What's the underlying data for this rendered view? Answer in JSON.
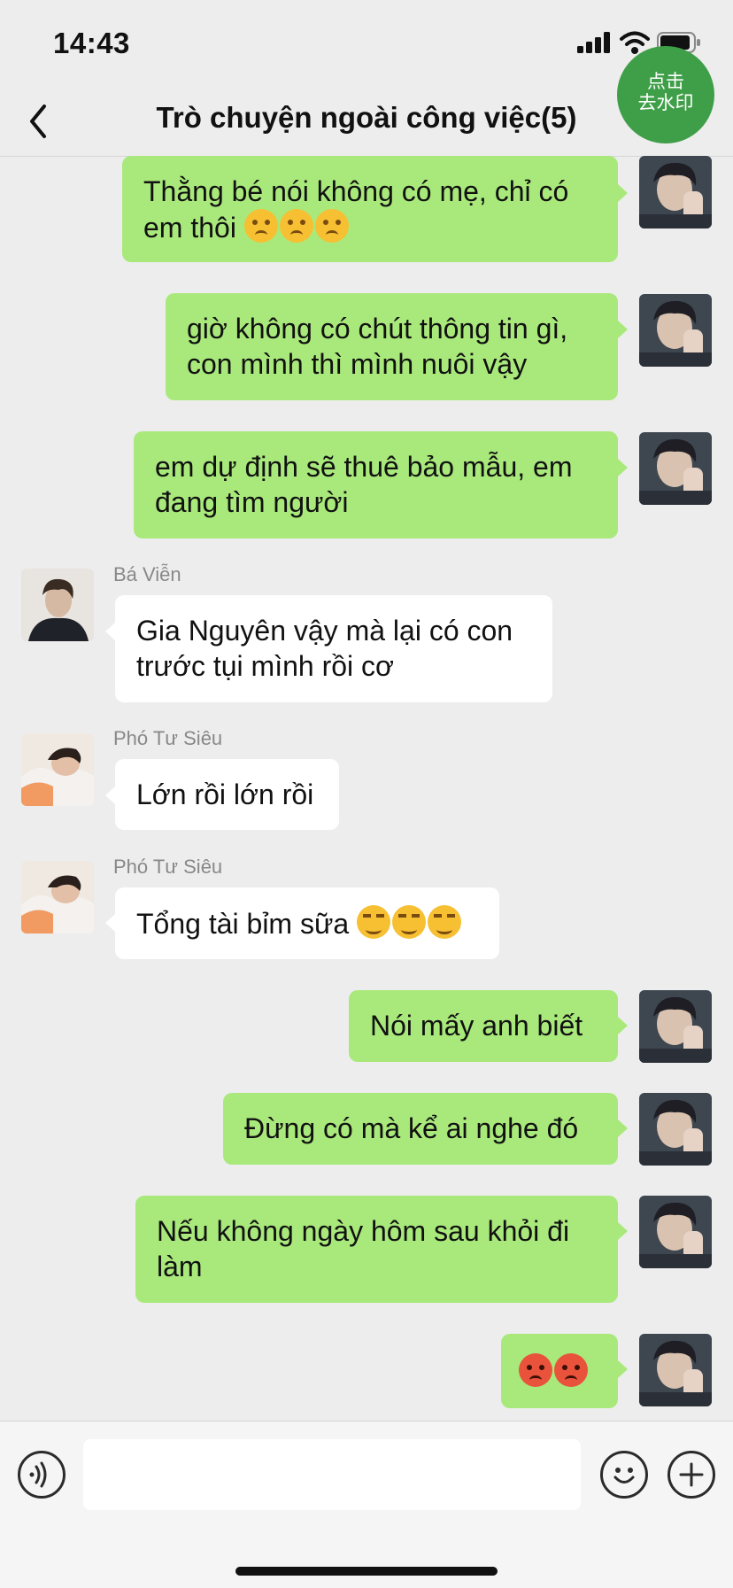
{
  "status_bar": {
    "time": "14:43"
  },
  "header": {
    "title": "Trò chuyện ngoài công việc(5)"
  },
  "watermark_badge": {
    "line1": "点击",
    "line2": "去水印"
  },
  "messages": [
    {
      "text": "Thằng bé nói không có mẹ, chỉ có em thôi",
      "emojis": [
        "sad-emoji",
        "sad-emoji",
        "sad-emoji"
      ]
    },
    {
      "text": "giờ không có chút thông tin gì, con mình thì mình nuôi vậy"
    },
    {
      "text": "em dự định sẽ thuê bảo mẫu, em đang tìm người"
    },
    {
      "sender": "Bá Viễn",
      "text": "Gia Nguyên vậy mà lại có con trước tụi mình rồi cơ"
    },
    {
      "sender": "Phó Tư Siêu",
      "text": "Lớn rồi lớn rồi"
    },
    {
      "sender": "Phó Tư Siêu",
      "text": "Tổng tài bỉm sữa",
      "emojis": [
        "smirk-emoji",
        "smirk-emoji",
        "smirk-emoji"
      ]
    },
    {
      "text": "Nói mấy anh biết"
    },
    {
      "text": "Đừng có mà kể ai nghe đó"
    },
    {
      "text": "Nếu không ngày hôm sau khỏi đi làm"
    },
    {
      "text": "",
      "emojis": [
        "angry-emoji",
        "angry-emoji"
      ]
    }
  ],
  "input_bar": {
    "text": ""
  },
  "colors": {
    "background": "#ededed",
    "outgoing_bubble": "#a9e97b",
    "incoming_bubble": "#ffffff",
    "badge": "#3f9f48"
  },
  "icons": [
    "back-chevron-icon",
    "voice-icon",
    "emoji-icon",
    "plus-icon",
    "signal-icon",
    "wifi-icon",
    "battery-icon"
  ]
}
